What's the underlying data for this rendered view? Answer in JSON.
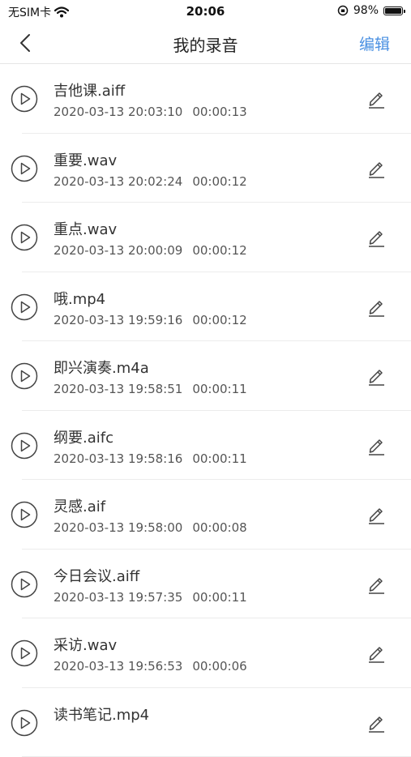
{
  "status": {
    "carrier": "无SIM卡",
    "time": "20:06",
    "battery_percent": "98%",
    "battery_level": 0.98
  },
  "nav": {
    "title": "我的录音",
    "edit_label": "编辑"
  },
  "recordings": [
    {
      "name": "吉他课.aiff",
      "date": "2020-03-13 20:03:10",
      "duration": "00:00:13"
    },
    {
      "name": "重要.wav",
      "date": "2020-03-13 20:02:24",
      "duration": "00:00:12"
    },
    {
      "name": "重点.wav",
      "date": "2020-03-13 20:00:09",
      "duration": "00:00:12"
    },
    {
      "name": "哦.mp4",
      "date": "2020-03-13 19:59:16",
      "duration": "00:00:12"
    },
    {
      "name": "即兴演奏.m4a",
      "date": "2020-03-13 19:58:51",
      "duration": "00:00:11"
    },
    {
      "name": "纲要.aifc",
      "date": "2020-03-13 19:58:16",
      "duration": "00:00:11"
    },
    {
      "name": "灵感.aif",
      "date": "2020-03-13 19:58:00",
      "duration": "00:00:08"
    },
    {
      "name": "今日会议.aiff",
      "date": "2020-03-13 19:57:35",
      "duration": "00:00:11"
    },
    {
      "name": "采访.wav",
      "date": "2020-03-13 19:56:53",
      "duration": "00:00:06"
    },
    {
      "name": "读书笔记.mp4",
      "date": "",
      "duration": ""
    }
  ]
}
